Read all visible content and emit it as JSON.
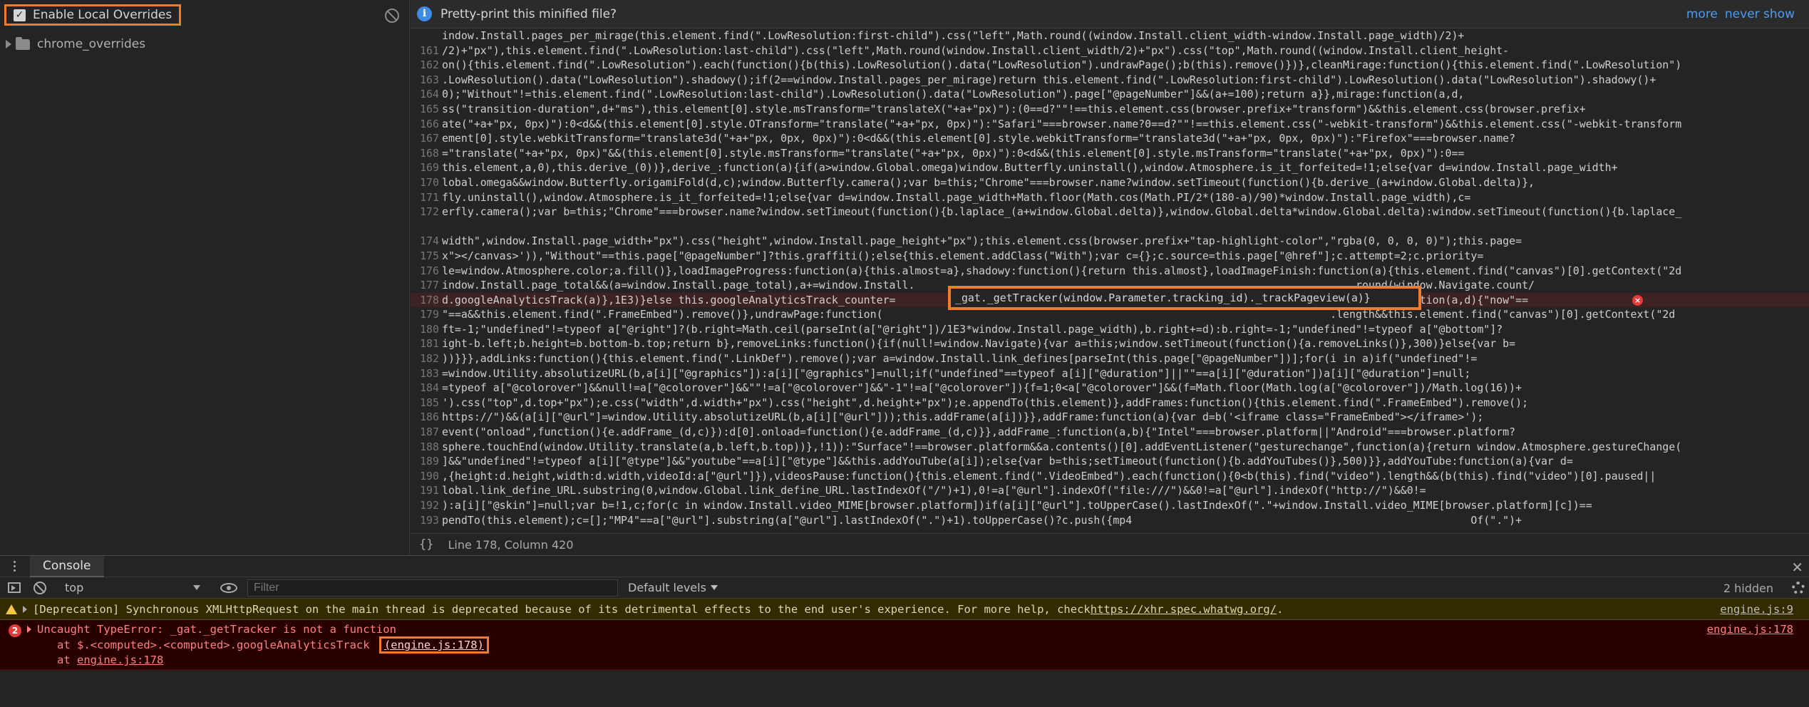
{
  "sources": {
    "enable_overrides_label": "Enable Local Overrides",
    "folder_label": "chrome_overrides"
  },
  "infobar": {
    "message": "Pretty-print this minified file?",
    "more_link": "more",
    "never_show_link": "never show"
  },
  "code_lines": [
    {
      "n": "",
      "t": "indow.Install.pages_per_mirage(this.element.find(\".LowResolution:first-child\").css(\"left\",Math.round((window.Install.client_width-window.Install.page_width)/2)+"
    },
    {
      "n": "161",
      "t": "/2)+\"px\"),this.element.find(\".LowResolution:last-child\").css(\"left\",Math.round(window.Install.client_width/2)+\"px\").css(\"top\",Math.round((window.Install.client_height-"
    },
    {
      "n": "162",
      "t": "on(){this.element.find(\".LowResolution\").each(function(){b(this).LowResolution().data(\"LowResolution\").undrawPage();b(this).remove()})},cleanMirage:function(){this.element.find(\".LowResolution\")"
    },
    {
      "n": "163",
      "t": ".LowResolution().data(\"LowResolution\").shadowy();if(2==window.Install.pages_per_mirage)return this.element.find(\".LowResolution:first-child\").LowResolution().data(\"LowResolution\").shadowy()+"
    },
    {
      "n": "164",
      "t": "0);\"Without\"!=this.element.find(\".LowResolution:last-child\").LowResolution().data(\"LowResolution\").page[\"@pageNumber\"]&&(a+=100);return a}},mirage:function(a,d,"
    },
    {
      "n": "165",
      "t": "ss(\"transition-duration\",d+\"ms\"),this.element[0].style.msTransform=\"translateX(\"+a+\"px)\"):(0==d?\"\"!==this.element.css(browser.prefix+\"transform\")&&this.element.css(browser.prefix+"
    },
    {
      "n": "166",
      "t": "ate(\"+a+\"px, 0px)\"):0<d&&(this.element[0].style.OTransform=\"translate(\"+a+\"px, 0px)\"):\"Safari\"===browser.name?0==d?\"\"!==this.element.css(\"-webkit-transform\")&&this.element.css(\"-webkit-transform"
    },
    {
      "n": "167",
      "t": "ement[0].style.webkitTransform=\"translate3d(\"+a+\"px, 0px, 0px)\"):0<d&&(this.element[0].style.webkitTransform=\"translate3d(\"+a+\"px, 0px, 0px)\"):\"Firefox\"===browser.name?"
    },
    {
      "n": "168",
      "t": "=\"translate(\"+a+\"px, 0px)\"&&(this.element[0].style.msTransform=\"translate(\"+a+\"px, 0px)\"):0<d&&(this.element[0].style.msTransform=\"translate(\"+a+\"px, 0px)\"):0=="
    },
    {
      "n": "169",
      "t": "this.element,a,0),this.derive_(0))},derive_:function(a){if(a>window.Global.omega)window.Butterfly.uninstall(),window.Atmosphere.is_it_forfeited=!1;else{var d=window.Install.page_width+"
    },
    {
      "n": "170",
      "t": "lobal.omega&&window.Butterfly.origamiFold(d,c);window.Butterfly.camera();var b=this;\"Chrome\"===browser.name?window.setTimeout(function(){b.derive_(a+window.Global.delta)},"
    },
    {
      "n": "171",
      "t": "fly.uninstall(),window.Atmosphere.is_it_forfeited=!1;else{var d=window.Install.page_width+Math.floor(Math.cos(Math.PI/2*(180-a)/90)*window.Install.page_width),c="
    },
    {
      "n": "172",
      "t": "erfly.camera();var b=this;\"Chrome\"===browser.name?window.setTimeout(function(){b.laplace_(a+window.Global.delta)},window.Global.delta*window.Global.delta):window.setTimeout(function(){b.laplace_"
    },
    {
      "n": "",
      "t": ""
    },
    {
      "n": "174",
      "t": "width\",window.Install.page_width+\"px\").css(\"height\",window.Install.page_height+\"px\");this.element.css(browser.prefix+\"tap-highlight-color\",\"rgba(0, 0, 0, 0)\");this.page="
    },
    {
      "n": "175",
      "t": "x\"></canvas>')),\"Without\"==this.page[\"@pageNumber\"]?this.graffiti();else{this.element.addClass(\"With\");var c={};c.source=this.page[\"@href\"];c.attempt=2;c.priority="
    },
    {
      "n": "176",
      "t": "le=window.Atmosphere.color;a.fill()},loadImageProgress:function(a){this.almost=a},shadowy:function(){return this.almost},loadImageFinish:function(a){this.element.find(\"canvas\")[0].getContext(\"2d"
    },
    {
      "n": "177",
      "t": "indow.Install.page_total&&(a=window.Install.page_total),a+=window.Install.                                                                     round(window.Navigate.count/"
    },
    {
      "n": "178",
      "t": "d.googleAnalyticsTrack(a)},1E3)}else this.googleAnalyticsTrack_counter=                                                                     drawPage:function(a,d){\"now\"=="
    },
    {
      "n": "179",
      "t": "\"==a&&this.element.find(\".FrameEmbed\").remove()},undrawPage:function(                                                                      .length&&this.element.find(\"canvas\")[0].getContext(\"2d"
    },
    {
      "n": "180",
      "t": "ft=-1;\"undefined\"!=typeof a[\"@right\"]?(b.right=Math.ceil(parseInt(a[\"@right\"])/1E3*window.Install.page_width),b.right+=d):b.right=-1;\"undefined\"!=typeof a[\"@bottom\"]?"
    },
    {
      "n": "181",
      "t": "ight-b.left;b.height=b.bottom-b.top;return b},removeLinks:function(){if(null!=window.Navigate){var a=this;window.setTimeout(function(){a.removeLinks()},300)}else{var b="
    },
    {
      "n": "182",
      "t": "))}}},addLinks:function(){this.element.find(\".LinkDef\").remove();var a=window.Install.link_defines[parseInt(this.page[\"@pageNumber\"])];for(i in a)if(\"undefined\"!="
    },
    {
      "n": "183",
      "t": "=window.Utility.absolutizeURL(b,a[i][\"@graphics\"]):a[i][\"@graphics\"]=null;if(\"undefined\"==typeof a[i][\"@duration\"]||\"\"==a[i][\"@duration\"])a[i][\"@duration\"]=null;"
    },
    {
      "n": "184",
      "t": "=typeof a[\"@colorover\"]&&null!=a[\"@colorover\"]&&\"\"!=a[\"@colorover\"]&&\"-1\"!=a[\"@colorover\"]){f=1;0<a[\"@colorover\"]&&(f=Math.floor(Math.log(a[\"@colorover\"])/Math.log(16))+"
    },
    {
      "n": "185",
      "t": "').css(\"top\",d.top+\"px\");e.css(\"width\",d.width+\"px\").css(\"height\",d.height+\"px\");e.appendTo(this.element)},addFrames:function(){this.element.find(\".FrameEmbed\").remove();"
    },
    {
      "n": "186",
      "t": "https://\")&&(a[i][\"@url\"]=window.Utility.absolutizeURL(b,a[i][\"@url\"]));this.addFrame(a[i])}},addFrame:function(a){var d=b('<iframe class=\"FrameEmbed\"></iframe>');"
    },
    {
      "n": "187",
      "t": "event(\"onload\",function(){e.addFrame_(d,c)}):d[0].onload=function(){e.addFrame_(d,c)}},addFrame_:function(a,b){\"Intel\"===browser.platform||\"Android\"===browser.platform?"
    },
    {
      "n": "188",
      "t": "sphere.touchEnd(window.Utility.translate(a,b.left,b.top))},!1)):\"Surface\"!==browser.platform&&a.contents()[0].addEventListener(\"gesturechange\",function(a){return window.Atmosphere.gestureChange("
    },
    {
      "n": "189",
      "t": "]&&\"undefined\"!=typeof a[i][\"@type\"]&&\"youtube\"==a[i][\"@type\"]&&this.addYouTube(a[i]);else{var b=this;setTimeout(function(){b.addYouTubes()},500)}},addYouTube:function(a){var d="
    },
    {
      "n": "190",
      "t": ",{height:d.height,width:d.width,videoId:a[\"@url\"]}),videosPause:function(){this.element.find(\".VideoEmbed\").each(function(){0<b(this).find(\"video\").length&&(b(this).find(\"video\")[0].paused||"
    },
    {
      "n": "191",
      "t": "lobal.link_define_URL.substring(0,window.Global.link_define_URL.lastIndexOf(\"/\")+1),0!=a[\"@url\"].indexOf(\"file:///\")&&0!=a[\"@url\"].indexOf(\"http://\")&&0!="
    },
    {
      "n": "192",
      "t": "):a[i][\"@skin\"]=null;var b=!1,c;for(c in window.Install.video_MIME[browser.platform])if(a[i][\"@url\"].toUpperCase().lastIndexOf(\".\"+window.Install.video_MIME[browser.platform][c])=="
    },
    {
      "n": "193",
      "t": "pendTo(this.element);c=[];\"MP4\"==a[\"@url\"].substring(a[\"@url\"].lastIndexOf(\".\")+1).toUpperCase()?c.push({mp4                                                     Of(\".\")+"
    }
  ],
  "highlight_code": "_gat._getTracker(window.Parameter.tracking_id)._trackPageview(a)}",
  "editor_status": {
    "position": "Line 178, Column 420"
  },
  "console": {
    "tab_label": "Console",
    "context": "top",
    "filter_placeholder": "Filter",
    "levels": "Default levels",
    "hidden": "2 hidden",
    "warning": {
      "text": "[Deprecation] Synchronous XMLHttpRequest on the main thread is deprecated because of its detrimental effects to the end user's experience. For more help, check ",
      "link": "https://xhr.spec.whatwg.org/",
      "tail": ".",
      "source": "engine.js:9"
    },
    "error": {
      "count": "2",
      "text": "Uncaught TypeError: _gat._getTracker is not a function",
      "source": "engine.js:178",
      "trace1_prefix": "at $.<computed>.<computed>.googleAnalyticsTrack ",
      "trace1_link": "(engine.js:178)",
      "trace2_prefix": "at ",
      "trace2_link": "engine.js:178"
    }
  },
  "colors": {
    "highlight_border": "#f07b2e",
    "info_blue": "#3c8be4",
    "error_red": "#e23b3b",
    "warning_yellow": "#f5c742"
  }
}
